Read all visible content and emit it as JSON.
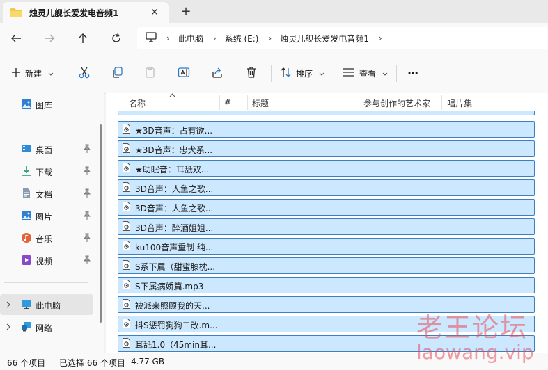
{
  "window": {
    "tab_title": "烛灵儿舰长爱发电音频1",
    "close_glyph": "✕",
    "new_tab_glyph": "+"
  },
  "address": {
    "crumbs": [
      "此电脑",
      "系统 (E:)",
      "烛灵儿舰长爱发电音频1"
    ],
    "separator": "›"
  },
  "toolbar": {
    "new_label": "新建",
    "sort_label": "排序",
    "view_label": "查看",
    "more_glyph": "···"
  },
  "sidebar": {
    "items": [
      {
        "label": "图库",
        "icon": "gallery-icon"
      },
      {
        "label": "桌面",
        "icon": "desktop-icon",
        "pinned": true
      },
      {
        "label": "下载",
        "icon": "download-icon",
        "pinned": true
      },
      {
        "label": "文档",
        "icon": "document-icon",
        "pinned": true
      },
      {
        "label": "图片",
        "icon": "pictures-icon",
        "pinned": true
      },
      {
        "label": "音乐",
        "icon": "music-icon",
        "pinned": true
      },
      {
        "label": "视频",
        "icon": "video-icon",
        "pinned": true
      },
      {
        "label": "此电脑",
        "icon": "this-pc-icon",
        "selected": true
      },
      {
        "label": "网络",
        "icon": "network-icon"
      }
    ]
  },
  "columns": [
    "名称",
    "#",
    "标题",
    "参与创作的艺术家",
    "唱片集"
  ],
  "files": [
    "★3D音声：占有欲...",
    "★3D音声：忠犬系...",
    "★助眠音：耳舐双...",
    "3D音声：人鱼之歌...",
    "3D音声：人鱼之歌...",
    "3D音声：醉酒姐姐...",
    "ku100音声重制 纯...",
    "S系下属（甜蜜膝枕...",
    "S下属病娇篇.mp3",
    "被派来照顾我的天...",
    "抖S惩罚狗狗二改.m...",
    "耳舐1.0（45min耳..."
  ],
  "status": {
    "count": "66 个项目",
    "selected": "已选择 66 个项目",
    "size": "4.77 GB"
  },
  "watermark": {
    "line1": "老王论坛",
    "line2": "laowang.vip"
  },
  "colors": {
    "selection_bg": "#cce8ff",
    "selection_border": "#3d7fc2",
    "accent": "#0067c0",
    "watermark": "#e74c5a"
  }
}
